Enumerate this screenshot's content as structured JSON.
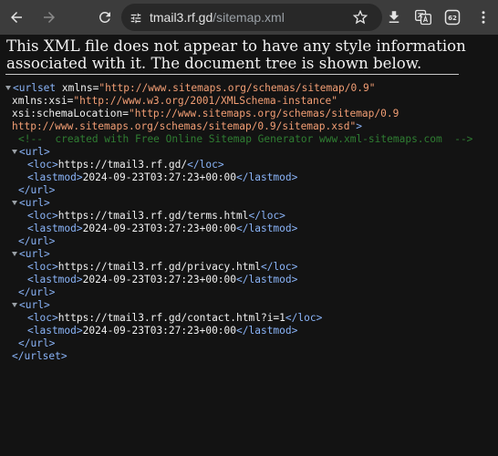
{
  "browser": {
    "url_host": "tmail3.rf.gd",
    "url_path": "/sitemap.xml",
    "icons": {
      "back": "back-arrow-icon",
      "forward": "forward-arrow-icon",
      "reload": "reload-icon",
      "site_info": "tune-icon",
      "bookmark": "star-icon",
      "download": "download-icon",
      "translate": "translate-icon",
      "tabs": "tab-switcher-icon",
      "menu": "more-vert-icon"
    },
    "tab_count": "62"
  },
  "document": {
    "info_text": "This XML file does not appear to have any style information associated with it. The document tree is shown below."
  },
  "xml": {
    "urlset_open": "<urlset",
    "xmlns_attr": "xmlns=",
    "xmlns_val": "\"http://www.sitemaps.org/schemas/sitemap/0.9\"",
    "xsi_attr": "xmlns:xsi=",
    "xsi_val": "\"http://www.w3.org/2001/XMLSchema-instance\"",
    "schema_attr": "xsi:schemaLocation=",
    "schema_val_1": "\"http://www.sitemaps.org/schemas/sitemap/0.9",
    "schema_val_2": "http://www.sitemaps.org/schemas/sitemap/0.9/sitemap.xsd\"",
    "tag_close_bracket": ">",
    "comment": "<!--  created with Free Online Sitemap Generator www.xml-sitemaps.com  -->",
    "url_open": "<url>",
    "url_close": "</url>",
    "loc_open": "<loc>",
    "loc_close": "</loc>",
    "lastmod_open": "<lastmod>",
    "lastmod_close": "</lastmod>",
    "urlset_close": "</urlset>",
    "entries": [
      {
        "loc": "https://tmail3.rf.gd/",
        "lastmod": "2024-09-23T03:27:23+00:00"
      },
      {
        "loc": "https://tmail3.rf.gd/terms.html",
        "lastmod": "2024-09-23T03:27:23+00:00"
      },
      {
        "loc": "https://tmail3.rf.gd/privacy.html",
        "lastmod": "2024-09-23T03:27:23+00:00"
      },
      {
        "loc": "https://tmail3.rf.gd/contact.html?i=1",
        "lastmod": "2024-09-23T03:27:23+00:00"
      }
    ]
  }
}
